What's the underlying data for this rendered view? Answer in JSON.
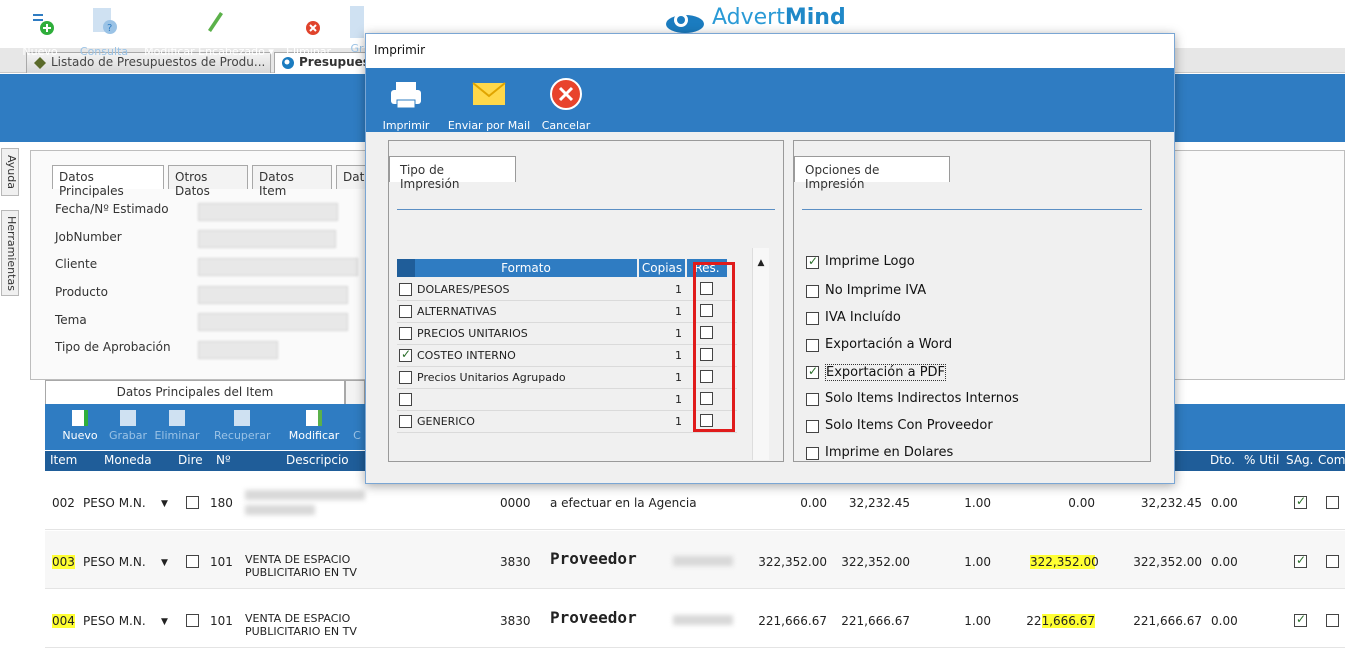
{
  "brand": {
    "name_prefix": "Advert",
    "name_suffix": "Mind"
  },
  "tabs": [
    {
      "label": "Listado de Presupuestos de Produ..."
    },
    {
      "label": "Presupuesto"
    }
  ],
  "main_toolbar": {
    "nuevo": "Nuevo",
    "consulta": "Consulta",
    "modificar": "Modificar Encabezado ▾",
    "eliminar": "Eliminar",
    "gr": "Gr"
  },
  "side_tabs": {
    "ayuda": "Ayuda",
    "herramientas": "Herramientas"
  },
  "inner_tabs": [
    "Datos Principales",
    "Otros Datos",
    "Datos Item",
    "Dat"
  ],
  "form_labels": [
    "Fecha/Nº Estimado",
    "JobNumber",
    "Cliente",
    "Producto",
    "Tema",
    "Tipo de Aprobación"
  ],
  "sub_tabs": {
    "item_tab": "Datos Principales del Item"
  },
  "sub_toolbar": {
    "nuevo": "Nuevo",
    "grabar": "Grabar",
    "eliminar": "Eliminar",
    "recuperar": "Recuperar",
    "modificar": "Modificar",
    "c": "C"
  },
  "grid_headers": {
    "item": "Item",
    "moneda": "Moneda",
    "dire": "Dire",
    "n": "Nº",
    "desc": "Descripcio",
    "dto": "Dto.",
    "util": "% Util",
    "sag": "SAg.",
    "com": "Com"
  },
  "rows": [
    {
      "item": "002",
      "moneda": "PESO M.N.",
      "n": "180",
      "desc": "",
      "code": "0000",
      "detail": "a efectuar en la Agencia",
      "v1": "0.00",
      "v2": "32,232.45",
      "v3": "1.00",
      "v4": "0.00",
      "v5": "32,232.45",
      "dto": "0.00"
    },
    {
      "item": "003",
      "moneda": "PESO M.N.",
      "n": "101",
      "desc": "VENTA DE ESPACIO PUBLICITARIO EN TV",
      "code": "3830",
      "detail": "Proveedor",
      "v1": "322,352.00",
      "v2": "322,352.00",
      "v3": "1.00",
      "v4": "322,352.00",
      "v5": "322,352.00",
      "dto": "0.00"
    },
    {
      "item": "004",
      "moneda": "PESO M.N.",
      "n": "101",
      "desc": "VENTA DE ESPACIO PUBLICITARIO EN TV",
      "code": "3830",
      "detail": "Proveedor",
      "v1": "221,666.67",
      "v2": "221,666.67",
      "v3": "1.00",
      "v4a": "22",
      "v4b": "1,666.67",
      "v5": "221,666.67",
      "dto": "0.00"
    }
  ],
  "dialog": {
    "title": "Imprimir",
    "toolbar": {
      "imprimir": "Imprimir",
      "mail": "Enviar por Mail",
      "cancelar": "Cancelar"
    },
    "tipo_tab": "Tipo de Impresión",
    "opciones_tab": "Opciones de Impresión",
    "table_headers": {
      "formato": "Formato",
      "copias": "Copias",
      "res": "Res."
    },
    "formats": [
      {
        "label": "DOLARES/PESOS",
        "copias": "1",
        "checked": false
      },
      {
        "label": "ALTERNATIVAS",
        "copias": "1",
        "checked": false
      },
      {
        "label": "PRECIOS UNITARIOS",
        "copias": "1",
        "checked": false
      },
      {
        "label": "COSTEO INTERNO",
        "copias": "1",
        "checked": true
      },
      {
        "label": "Precios Unitarios Agrupado",
        "copias": "1",
        "checked": false
      },
      {
        "label": "",
        "copias": "1",
        "checked": false
      },
      {
        "label": "GENERICO",
        "copias": "1",
        "checked": false
      }
    ],
    "options": [
      {
        "label": "Imprime Logo",
        "checked": true
      },
      {
        "label": "No Imprime IVA",
        "checked": false
      },
      {
        "label": "IVA Incluído",
        "checked": false
      },
      {
        "label": "Exportación a Word",
        "checked": false
      },
      {
        "label": "Exportación a PDF",
        "checked": true
      },
      {
        "label": "Solo Items Indirectos Internos",
        "checked": false
      },
      {
        "label": "Solo Items Con Proveedor",
        "checked": false
      },
      {
        "label": "Imprime en Dolares",
        "checked": false
      }
    ]
  },
  "colors": {
    "toolbar_blue": "#2f7cc2",
    "grid_head": "#1f5d99",
    "highlight": "#ffff33",
    "red_frame": "#e01b1b"
  }
}
